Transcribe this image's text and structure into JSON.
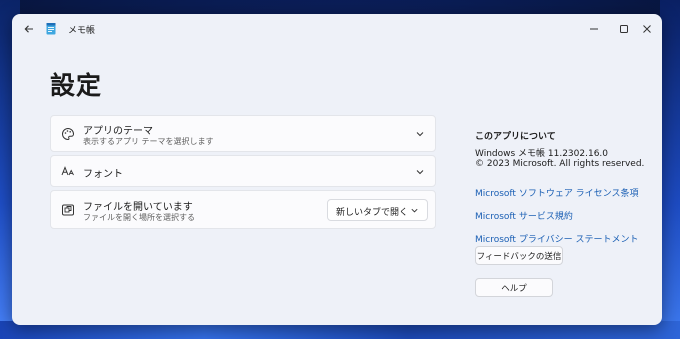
{
  "window": {
    "title": "メモ帳"
  },
  "page": {
    "title": "設定"
  },
  "settings": {
    "theme": {
      "label": "アプリのテーマ",
      "description": "表示するアプリ テーマを選択します"
    },
    "font": {
      "label": "フォント"
    },
    "file_open": {
      "label": "ファイルを開いています",
      "description": "ファイルを開く場所を選択する",
      "selected_option": "新しいタブで開く"
    }
  },
  "about": {
    "title": "このアプリについて",
    "version": "Windows メモ帳 11.2302.16.0",
    "copyright": "© 2023 Microsoft. All rights reserved.",
    "links": {
      "license": "Microsoft ソフトウェア ライセンス条項",
      "terms": "Microsoft サービス規約",
      "privacy": "Microsoft プライバシー ステートメント"
    },
    "buttons": {
      "feedback": "フィードバックの送信",
      "help": "ヘルプ"
    }
  },
  "colors": {
    "window_bg": "#eef1f8",
    "card_bg": "#fbfbfd",
    "link": "#1a5fb4",
    "text": "#1b1b1b"
  },
  "icons": {
    "back": "arrow-left-icon",
    "app": "notepad-icon",
    "minimize": "minimize-icon",
    "maximize": "maximize-icon",
    "close": "close-icon",
    "theme": "palette-icon",
    "font": "font-icon",
    "file_open": "open-file-icon",
    "chevron": "chevron-down-icon"
  }
}
